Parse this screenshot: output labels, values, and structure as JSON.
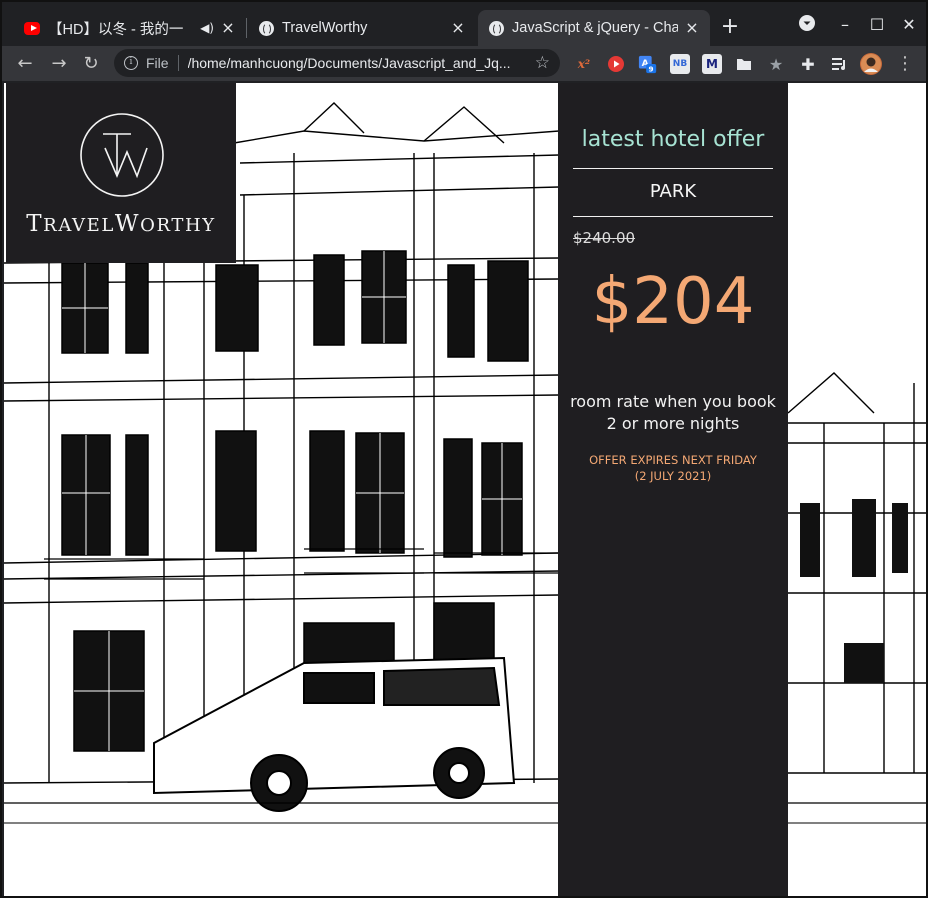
{
  "browser": {
    "tabs": [
      {
        "title": "【HD】以冬 - 我的一",
        "favicon": "youtube-icon",
        "audio": true
      },
      {
        "title": "TravelWorthy",
        "favicon": "globe-icon"
      },
      {
        "title": "JavaScript & jQuery - Cha",
        "favicon": "globe-icon",
        "active": true
      }
    ],
    "new_tab": "+",
    "omnibox": {
      "scheme_label": "File",
      "url": "/home/manhcuong/Documents/Javascript_and_Jq..."
    },
    "extensions": [
      "x² extension",
      "video extension",
      "translate extension",
      "notebook extension",
      "M extension",
      "folder extension",
      "bookmark extension",
      "puzzle-icon",
      "media-list-icon",
      "profile-avatar"
    ],
    "translate_badge": "9",
    "accent": "#35363a"
  },
  "page": {
    "logo": {
      "monogram": "TW",
      "name_cap_1": "T",
      "name_rest_1": "RAVEL",
      "name_cap_2": "W",
      "name_rest_2": "ORTHY"
    },
    "offer": {
      "heading": "latest hotel offer",
      "hotel": "PARK",
      "original_price": "$240.00",
      "offer_price": "$204",
      "rate_text": "room rate when you book 2 or more nights",
      "expiry_line_1": "OFFER EXPIRES NEXT FRIDAY",
      "expiry_line_2": "(2 JULY 2021)"
    },
    "colors": {
      "panel_bg": "#1f1e21",
      "heading": "#a7e3d3",
      "price": "#f4a874"
    }
  }
}
